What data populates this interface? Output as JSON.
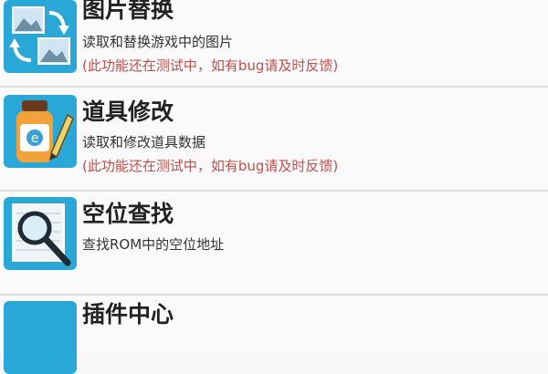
{
  "colors": {
    "icon_bg": "#29a8d8",
    "note_text": "#c0504d"
  },
  "items": [
    {
      "icon": "image-swap-icon",
      "title": "图片替换",
      "desc": "读取和替换游戏中的图片",
      "note": "(此功能还在测试中，如有bug请及时反馈)"
    },
    {
      "icon": "potion-bottle-edit-icon",
      "title": "道具修改",
      "desc": "读取和修改道具数据",
      "note": "(此功能还在测试中，如有bug请及时反馈)"
    },
    {
      "icon": "magnifier-icon",
      "title": "空位查找",
      "desc": "查找ROM中的空位地址"
    },
    {
      "icon": "blue-icon",
      "title": "插件中心"
    }
  ]
}
